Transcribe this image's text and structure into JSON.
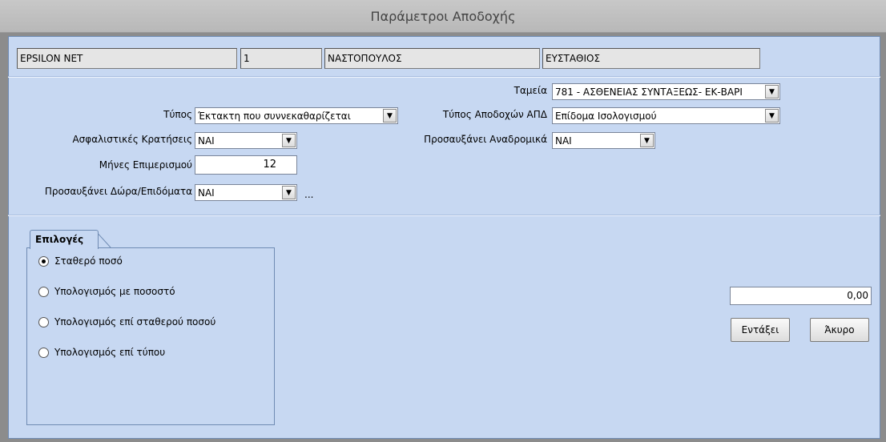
{
  "window": {
    "title": "Παράμετροι Αποδοχής"
  },
  "header": {
    "company": "EPSILON NET",
    "code": "1",
    "surname": "ΝΑΣΤΟΠΟΥΛΟΣ",
    "firstname": "ΕΥΣΤΑΘΙΟΣ"
  },
  "form": {
    "tameia": {
      "label": "Ταμεία",
      "value": "781 - ΑΣΘΕΝΕΙΑΣ ΣΥΝΤΑΞΕΩΣ- ΕΚ-ΒΑΡΙ"
    },
    "typos": {
      "label": "Τύπος",
      "value": "Έκτακτη που συννεκαθαρίζεται"
    },
    "typos_apodoxon_apd": {
      "label": "Τύπος Αποδοχών ΑΠΔ",
      "value": "Επίδομα Ισολογισμού"
    },
    "asfalistikes": {
      "label": "Ασφαλιστικές Κρατήσεις",
      "value": "ΝΑΙ"
    },
    "prosafxanei_anadromika": {
      "label": "Προσαυξάνει Αναδρομικά",
      "value": "ΝΑΙ"
    },
    "mines_epimerismou": {
      "label": "Μήνες Επιμερισμού",
      "value": "12"
    },
    "prosafxanei_dora": {
      "label": "Προσαυξάνει Δώρα/Επιδόματα",
      "value": "ΝΑΙ",
      "extra": "..."
    }
  },
  "options": {
    "tab_label": "Επιλογές",
    "selected_index": 0,
    "items": [
      {
        "label": "Σταθερό ποσό"
      },
      {
        "label": "Υπολογισμός με ποσοστό"
      },
      {
        "label": "Υπολογισμός επί σταθερού ποσού"
      },
      {
        "label": "Υπολογισμός επί τύπου"
      }
    ]
  },
  "amount": "0,00",
  "buttons": {
    "ok": "Εντάξει",
    "cancel": "Άκυρο"
  }
}
